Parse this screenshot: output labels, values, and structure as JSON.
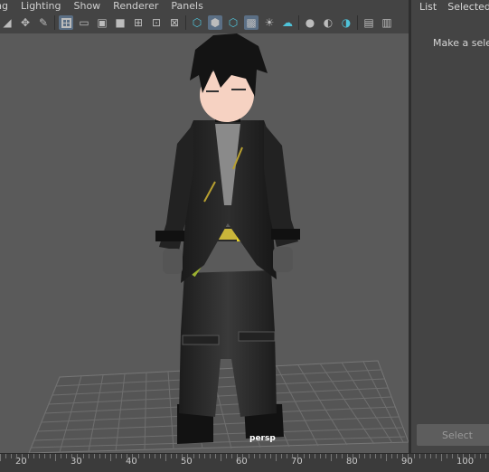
{
  "viewport_menu": [
    "ing",
    "Lighting",
    "Show",
    "Renderer",
    "Panels"
  ],
  "toolbar_icons": [
    {
      "name": "select-camera-icon",
      "glyph": "◢"
    },
    {
      "name": "track-tool-icon",
      "glyph": "✥"
    },
    {
      "name": "brush-icon",
      "glyph": "✎"
    },
    {
      "name": "grid-icon",
      "glyph": "",
      "active": true
    },
    {
      "name": "film-gate-icon",
      "glyph": "▭"
    },
    {
      "name": "resolution-gate-icon",
      "glyph": "▣"
    },
    {
      "name": "gate-mask-icon",
      "glyph": "■"
    },
    {
      "name": "field-chart-icon",
      "glyph": "⊞"
    },
    {
      "name": "safe-action-icon",
      "glyph": "⊡"
    },
    {
      "name": "safe-title-icon",
      "glyph": "⊠"
    },
    {
      "name": "wireframe-cube-icon",
      "glyph": "⬡",
      "cyan": true
    },
    {
      "name": "smooth-shade-icon",
      "glyph": "⬢",
      "active": true
    },
    {
      "name": "shaded-wireframe-icon",
      "glyph": "⬡",
      "cyan": true
    },
    {
      "name": "textured-icon",
      "glyph": "▩",
      "active": true
    },
    {
      "name": "lights-icon",
      "glyph": "☀"
    },
    {
      "name": "shadows-icon",
      "glyph": "☁",
      "cyan": true
    },
    {
      "name": "ambient-occlusion-icon",
      "glyph": "●"
    },
    {
      "name": "motion-blur-icon",
      "glyph": "◐"
    },
    {
      "name": "multisample-icon",
      "glyph": "◑",
      "cyan": true
    },
    {
      "name": "isolate-select-icon",
      "glyph": "▤"
    },
    {
      "name": "xray-icon",
      "glyph": "▥"
    }
  ],
  "viewport": {
    "camera_label": "persp"
  },
  "time_ruler": {
    "labels": [
      "20",
      "30",
      "40",
      "50",
      "60",
      "70",
      "80",
      "90",
      "100"
    ]
  },
  "attribute_panel": {
    "menu": [
      "List",
      "Selected"
    ],
    "message": "Make a selec",
    "select_button": "Select"
  }
}
